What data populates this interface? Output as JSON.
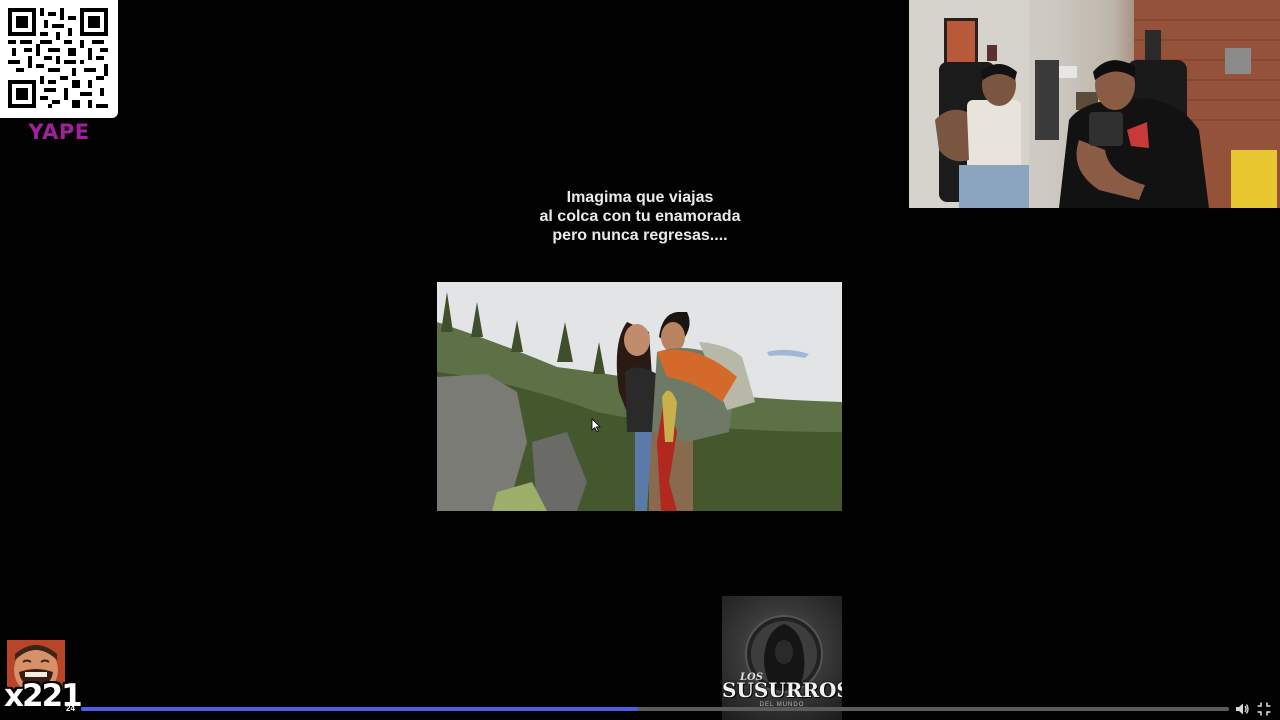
{
  "donation": {
    "label": "YAPE",
    "qr_icon": "qr-code-icon",
    "accent_color": "#a31f9d"
  },
  "caption": {
    "lines": [
      "Imagima que viajas",
      "al colca con tu enamorada",
      "pero nunca regresas...."
    ]
  },
  "logo": {
    "prefix": "LOS",
    "title": "SUSURROS",
    "subtitle": "DEL MUNDO"
  },
  "chat_emote": {
    "combo": "x221",
    "small": "24"
  },
  "player": {
    "progress_percent": 48.5,
    "progress_color": "#4b5ee6",
    "volume_icon": "volume-icon",
    "exit_fullscreen_icon": "exit-fullscreen-icon"
  }
}
